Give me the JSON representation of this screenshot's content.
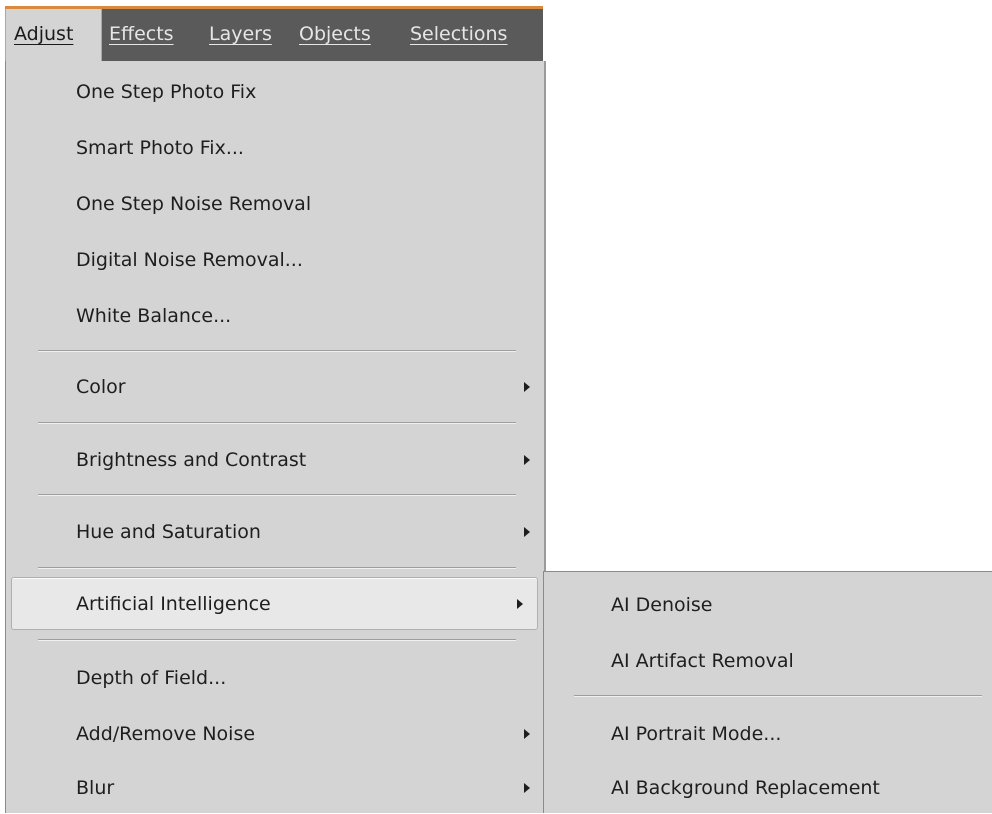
{
  "menubar": {
    "items": [
      {
        "label": "Adjust"
      },
      {
        "label": "Effects"
      },
      {
        "label": "Layers"
      },
      {
        "label": "Objects"
      },
      {
        "label": "Selections"
      }
    ]
  },
  "adjust_menu": {
    "items": [
      {
        "label": "One Step Photo Fix"
      },
      {
        "label": "Smart Photo Fix..."
      },
      {
        "label": "One Step Noise Removal"
      },
      {
        "label": "Digital Noise Removal..."
      },
      {
        "label": "White Balance..."
      },
      {
        "label": "Color"
      },
      {
        "label": "Brightness and Contrast"
      },
      {
        "label": "Hue and Saturation"
      },
      {
        "label": "Artificial Intelligence"
      },
      {
        "label": "Depth of Field..."
      },
      {
        "label": "Add/Remove Noise"
      },
      {
        "label": "Blur"
      }
    ]
  },
  "ai_submenu": {
    "items": [
      {
        "label": "AI Denoise"
      },
      {
        "label": "AI Artifact Removal"
      },
      {
        "label": "AI Portrait Mode..."
      },
      {
        "label": "AI Background Replacement"
      }
    ]
  }
}
